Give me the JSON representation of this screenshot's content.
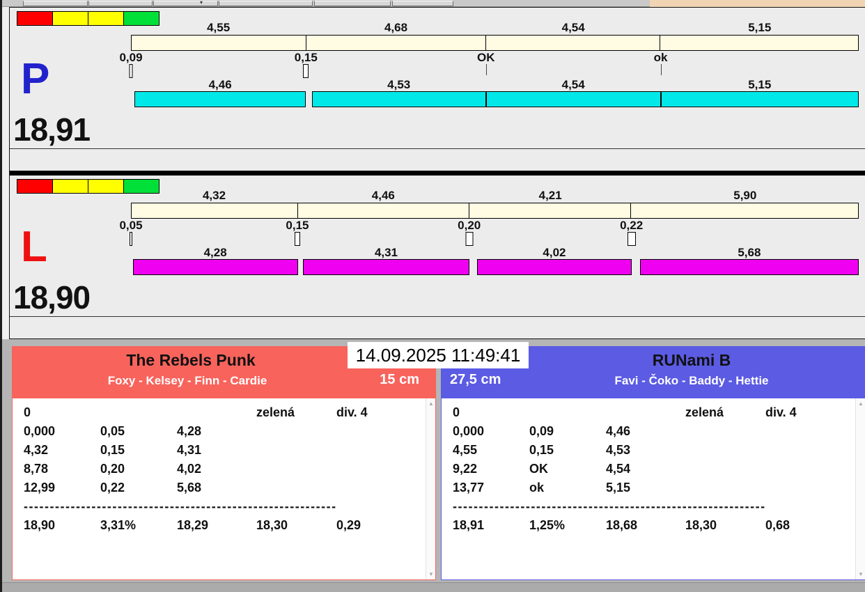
{
  "top_strip": {
    "peach_color": "#f1d4b4",
    "caret": "▾"
  },
  "traffic_lights": [
    "#ff0000",
    "#ffff00",
    "#ffff00",
    "#00e038"
  ],
  "sections": [
    {
      "letter": "P",
      "letter_color": "#2222cc",
      "total": "18,91",
      "top_bar": {
        "color": "#fffce3",
        "segments": [
          {
            "label": "4,55",
            "value": 4.55
          },
          {
            "label": "4,68",
            "value": 4.68
          },
          {
            "label": "4,54",
            "value": 4.54
          },
          {
            "label": "5,15",
            "value": 5.15
          }
        ]
      },
      "markers": [
        {
          "label": "0,09",
          "value": 0.09,
          "type": "box"
        },
        {
          "label": "0,15",
          "value": 0.15,
          "type": "box"
        },
        {
          "label": "OK",
          "value": 0,
          "type": "line"
        },
        {
          "label": "ok",
          "value": 0,
          "type": "line"
        }
      ],
      "bottom_bar": {
        "color": "#00e8e8",
        "segments": [
          {
            "label": "4,46",
            "value": 4.46
          },
          {
            "label": "4,53",
            "value": 4.53
          },
          {
            "label": "4,54",
            "value": 4.54
          },
          {
            "label": "5,15",
            "value": 5.15
          }
        ]
      }
    },
    {
      "letter": "L",
      "letter_color": "#ee1111",
      "total": "18,90",
      "top_bar": {
        "color": "#fffce3",
        "segments": [
          {
            "label": "4,32",
            "value": 4.32
          },
          {
            "label": "4,46",
            "value": 4.46
          },
          {
            "label": "4,21",
            "value": 4.21
          },
          {
            "label": "5,90",
            "value": 5.9
          }
        ]
      },
      "markers": [
        {
          "label": "0,05",
          "value": 0.05,
          "type": "box"
        },
        {
          "label": "0,15",
          "value": 0.15,
          "type": "box"
        },
        {
          "label": "0,20",
          "value": 0.2,
          "type": "box"
        },
        {
          "label": "0,22",
          "value": 0.22,
          "type": "box"
        }
      ],
      "bottom_bar": {
        "color": "#f000f0",
        "segments": [
          {
            "label": "4,28",
            "value": 4.28
          },
          {
            "label": "4,31",
            "value": 4.31
          },
          {
            "label": "4,02",
            "value": 4.02
          },
          {
            "label": "5,68",
            "value": 5.68
          }
        ]
      }
    }
  ],
  "timestamp": "14.09.2025 11:49:41",
  "panels": [
    {
      "team": "The Rebels Punk",
      "dogs": "Foxy - Kelsey - Finn - Cardie",
      "height_badge": "15 cm",
      "color": "#f8635c",
      "lines": [
        [
          "0",
          "",
          "",
          "zelená",
          "div. 4"
        ],
        [
          "0,000",
          "0,05",
          "4,28",
          "",
          ""
        ],
        [
          "4,32",
          "0,15",
          "4,31",
          "",
          ""
        ],
        [
          "8,78",
          "0,20",
          "4,02",
          "",
          ""
        ],
        [
          "12,99",
          "0,22",
          "5,68",
          "",
          ""
        ],
        "------------------------------------------------------------",
        [
          "18,90",
          "3,31%",
          "18,29",
          "18,30",
          "0,29"
        ]
      ]
    },
    {
      "team": "RUNami B",
      "dogs": "Favi - Čoko - Baddy - Hettie",
      "height_badge": "27,5 cm",
      "color": "#5b5be4",
      "lines": [
        [
          "0",
          "",
          "",
          "zelená",
          "div. 4"
        ],
        [
          "0,000",
          "0,09",
          "4,46",
          "",
          ""
        ],
        [
          "4,55",
          "0,15",
          "4,53",
          "",
          ""
        ],
        [
          "9,22",
          "OK",
          "4,54",
          "",
          ""
        ],
        [
          "13,77",
          "ok",
          "5,15",
          "",
          ""
        ],
        "------------------------------------------------------------",
        [
          "18,91",
          "1,25%",
          "18,68",
          "18,30",
          "0,68"
        ]
      ]
    }
  ],
  "icons": {
    "scroll_up": "▲",
    "scroll_down": "▼"
  }
}
